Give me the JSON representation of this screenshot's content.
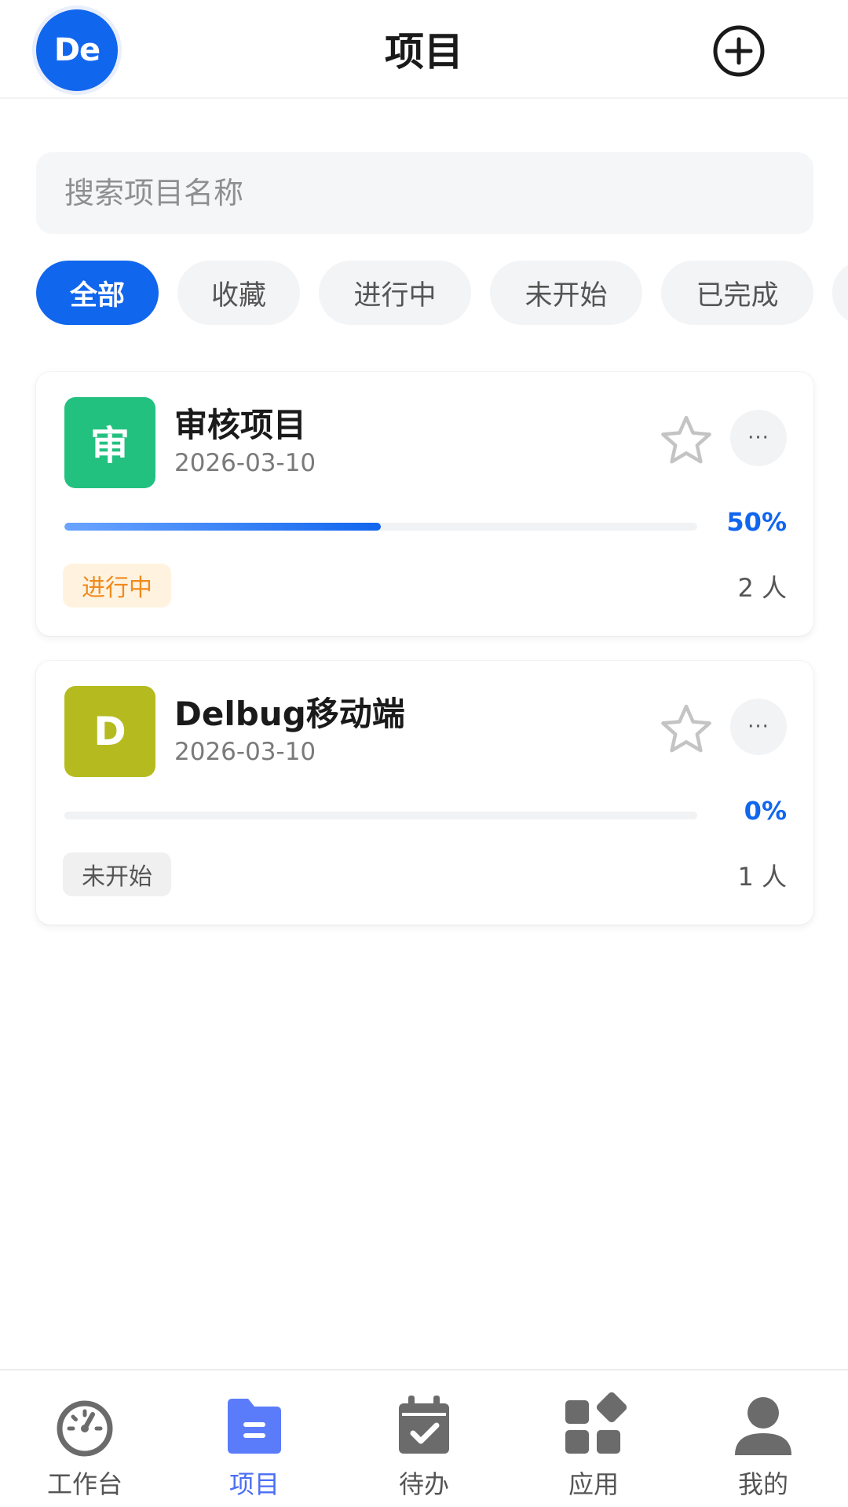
{
  "header": {
    "avatar_text": "De",
    "title": "项目"
  },
  "search": {
    "placeholder": "搜索项目名称",
    "value": ""
  },
  "filters": [
    {
      "label": "全部",
      "active": true
    },
    {
      "label": "收藏",
      "active": false
    },
    {
      "label": "进行中",
      "active": false
    },
    {
      "label": "未开始",
      "active": false
    },
    {
      "label": "已完成",
      "active": false
    }
  ],
  "projects": [
    {
      "logo_text": "审",
      "logo_color": "#22c17f",
      "name": "审核项目",
      "date": "2026-03-10",
      "progress": 0.5,
      "progress_label": "50%",
      "status": "进行中",
      "status_bg": "#fff3e0",
      "status_color": "#f08a1c",
      "members": "2 人"
    },
    {
      "logo_text": "D",
      "logo_color": "#b5bb1f",
      "name": "Delbug移动端",
      "date": "2026-03-10",
      "progress": 0,
      "progress_label": "0%",
      "status": "未开始",
      "status_bg": "#f0f0f0",
      "status_color": "#555555",
      "members": "1 人"
    }
  ],
  "more_label": "···",
  "bottom_nav": [
    {
      "label": "工作台",
      "icon": "dashboard-icon",
      "active": false
    },
    {
      "label": "项目",
      "icon": "folder-icon",
      "active": true
    },
    {
      "label": "待办",
      "icon": "calendar-check-icon",
      "active": false
    },
    {
      "label": "应用",
      "icon": "apps-icon",
      "active": false
    },
    {
      "label": "我的",
      "icon": "user-icon",
      "active": false
    }
  ],
  "colors": {
    "primary": "#1166ee",
    "nav_active": "#4c6ef5",
    "nav_inactive": "#6b6b6b"
  }
}
